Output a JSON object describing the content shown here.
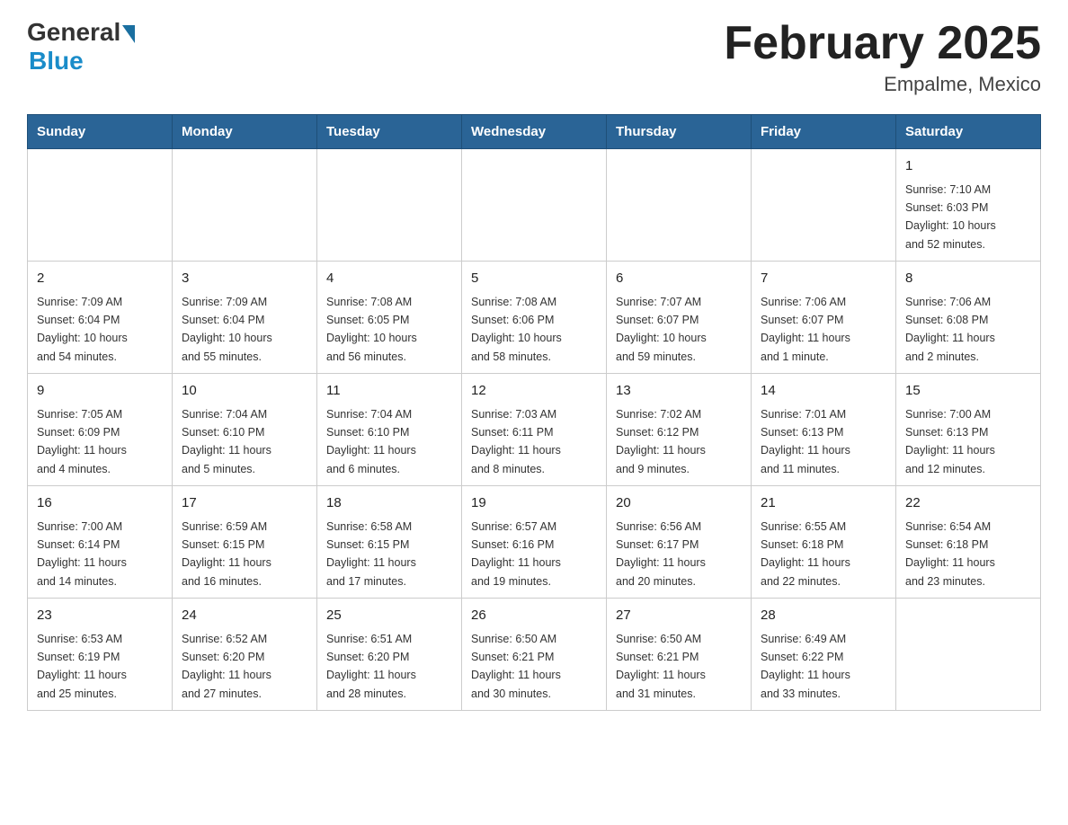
{
  "header": {
    "logo_general": "General",
    "logo_blue": "Blue",
    "title": "February 2025",
    "subtitle": "Empalme, Mexico"
  },
  "days_of_week": [
    "Sunday",
    "Monday",
    "Tuesday",
    "Wednesday",
    "Thursday",
    "Friday",
    "Saturday"
  ],
  "weeks": [
    [
      {
        "day": "",
        "info": ""
      },
      {
        "day": "",
        "info": ""
      },
      {
        "day": "",
        "info": ""
      },
      {
        "day": "",
        "info": ""
      },
      {
        "day": "",
        "info": ""
      },
      {
        "day": "",
        "info": ""
      },
      {
        "day": "1",
        "info": "Sunrise: 7:10 AM\nSunset: 6:03 PM\nDaylight: 10 hours\nand 52 minutes."
      }
    ],
    [
      {
        "day": "2",
        "info": "Sunrise: 7:09 AM\nSunset: 6:04 PM\nDaylight: 10 hours\nand 54 minutes."
      },
      {
        "day": "3",
        "info": "Sunrise: 7:09 AM\nSunset: 6:04 PM\nDaylight: 10 hours\nand 55 minutes."
      },
      {
        "day": "4",
        "info": "Sunrise: 7:08 AM\nSunset: 6:05 PM\nDaylight: 10 hours\nand 56 minutes."
      },
      {
        "day": "5",
        "info": "Sunrise: 7:08 AM\nSunset: 6:06 PM\nDaylight: 10 hours\nand 58 minutes."
      },
      {
        "day": "6",
        "info": "Sunrise: 7:07 AM\nSunset: 6:07 PM\nDaylight: 10 hours\nand 59 minutes."
      },
      {
        "day": "7",
        "info": "Sunrise: 7:06 AM\nSunset: 6:07 PM\nDaylight: 11 hours\nand 1 minute."
      },
      {
        "day": "8",
        "info": "Sunrise: 7:06 AM\nSunset: 6:08 PM\nDaylight: 11 hours\nand 2 minutes."
      }
    ],
    [
      {
        "day": "9",
        "info": "Sunrise: 7:05 AM\nSunset: 6:09 PM\nDaylight: 11 hours\nand 4 minutes."
      },
      {
        "day": "10",
        "info": "Sunrise: 7:04 AM\nSunset: 6:10 PM\nDaylight: 11 hours\nand 5 minutes."
      },
      {
        "day": "11",
        "info": "Sunrise: 7:04 AM\nSunset: 6:10 PM\nDaylight: 11 hours\nand 6 minutes."
      },
      {
        "day": "12",
        "info": "Sunrise: 7:03 AM\nSunset: 6:11 PM\nDaylight: 11 hours\nand 8 minutes."
      },
      {
        "day": "13",
        "info": "Sunrise: 7:02 AM\nSunset: 6:12 PM\nDaylight: 11 hours\nand 9 minutes."
      },
      {
        "day": "14",
        "info": "Sunrise: 7:01 AM\nSunset: 6:13 PM\nDaylight: 11 hours\nand 11 minutes."
      },
      {
        "day": "15",
        "info": "Sunrise: 7:00 AM\nSunset: 6:13 PM\nDaylight: 11 hours\nand 12 minutes."
      }
    ],
    [
      {
        "day": "16",
        "info": "Sunrise: 7:00 AM\nSunset: 6:14 PM\nDaylight: 11 hours\nand 14 minutes."
      },
      {
        "day": "17",
        "info": "Sunrise: 6:59 AM\nSunset: 6:15 PM\nDaylight: 11 hours\nand 16 minutes."
      },
      {
        "day": "18",
        "info": "Sunrise: 6:58 AM\nSunset: 6:15 PM\nDaylight: 11 hours\nand 17 minutes."
      },
      {
        "day": "19",
        "info": "Sunrise: 6:57 AM\nSunset: 6:16 PM\nDaylight: 11 hours\nand 19 minutes."
      },
      {
        "day": "20",
        "info": "Sunrise: 6:56 AM\nSunset: 6:17 PM\nDaylight: 11 hours\nand 20 minutes."
      },
      {
        "day": "21",
        "info": "Sunrise: 6:55 AM\nSunset: 6:18 PM\nDaylight: 11 hours\nand 22 minutes."
      },
      {
        "day": "22",
        "info": "Sunrise: 6:54 AM\nSunset: 6:18 PM\nDaylight: 11 hours\nand 23 minutes."
      }
    ],
    [
      {
        "day": "23",
        "info": "Sunrise: 6:53 AM\nSunset: 6:19 PM\nDaylight: 11 hours\nand 25 minutes."
      },
      {
        "day": "24",
        "info": "Sunrise: 6:52 AM\nSunset: 6:20 PM\nDaylight: 11 hours\nand 27 minutes."
      },
      {
        "day": "25",
        "info": "Sunrise: 6:51 AM\nSunset: 6:20 PM\nDaylight: 11 hours\nand 28 minutes."
      },
      {
        "day": "26",
        "info": "Sunrise: 6:50 AM\nSunset: 6:21 PM\nDaylight: 11 hours\nand 30 minutes."
      },
      {
        "day": "27",
        "info": "Sunrise: 6:50 AM\nSunset: 6:21 PM\nDaylight: 11 hours\nand 31 minutes."
      },
      {
        "day": "28",
        "info": "Sunrise: 6:49 AM\nSunset: 6:22 PM\nDaylight: 11 hours\nand 33 minutes."
      },
      {
        "day": "",
        "info": ""
      }
    ]
  ]
}
